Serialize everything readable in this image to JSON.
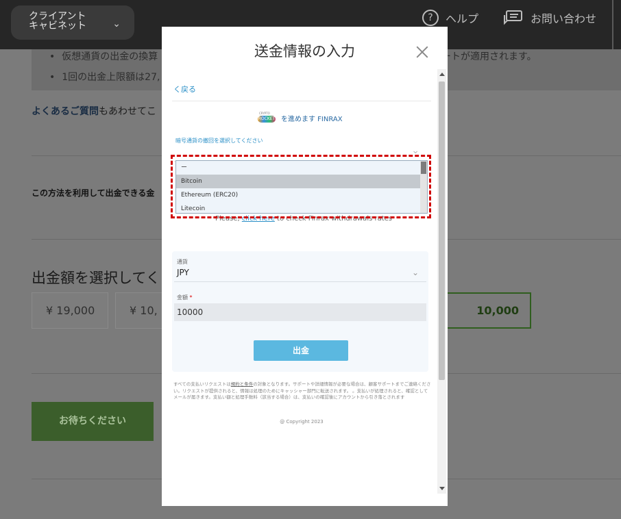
{
  "header": {
    "cabinet_label": "クライアント キャビネット",
    "help_label": "ヘルプ",
    "contact_label": "お問い合わせ"
  },
  "page": {
    "info_bullets": [
      "仮想通貨の出金の換算",
      "1回の出金上限額は27,",
      "レートが適用されます。"
    ],
    "faq_link": "よくあるご質問",
    "faq_rest": "もあわせてこ",
    "method_text": "この方法を利用して出金できる金",
    "amount_title": "出金額を選択してく",
    "amounts": [
      "¥ 19,000",
      "¥ 10,"
    ],
    "amount_selected": "10,000",
    "wait_button": "お待ちください"
  },
  "modal": {
    "title": "送金情報の入力",
    "back": "く戻る",
    "brand_top": "CRYPTO",
    "brand_mid": "ROCKET",
    "brand_text": "を進めます FINRAX",
    "currency_label": "暗号通貨の撤回を選択してください",
    "dropdown_options": [
      "ー",
      "Bitcoin",
      "Ethereum (ERC20)",
      "Litecoin"
    ],
    "rates_prefix": "Please, ",
    "rates_link": "click here",
    "rates_suffix": " to check Finrax withdrawals rates",
    "currency_field_label": "通貨",
    "currency_value": "JPY",
    "amount_label": "金額",
    "amount_required": "*",
    "amount_value": "10000",
    "submit": "出金",
    "legal_text_1": "すべての支払いリクエストは",
    "legal_link": "規約と条件",
    "legal_text_2": "の対象となります。サポートや詳細情報が必要な場合は、顧客サポートまでご連絡ください。リクエストが提供されると、情報は処理のためにキャッシャー部門に転送されます。 。支払いが処理されると、確認としてメールが届きます。支払い額と処理手数料（該当する場合）は、支払いの確認後にアカウントから引き落とされます",
    "copyright": "@ Copyright 2023"
  },
  "colors": {
    "link": "#2a8fc7",
    "submit": "#5bb8e0",
    "highlight": "#d00000",
    "green": "#3b5e2b"
  }
}
